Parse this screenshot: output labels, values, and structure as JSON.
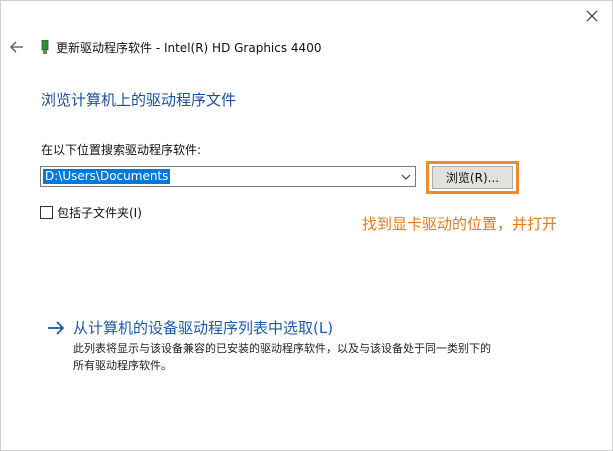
{
  "window": {
    "title": "更新驱动程序软件 - Intel(R) HD Graphics 4400"
  },
  "main": {
    "heading": "浏览计算机上的驱动程序文件",
    "search_label": "在以下位置搜索驱动程序软件:",
    "path_value": "D:\\Users\\Documents",
    "browse_label": "浏览(R)...",
    "include_subfolders_label": "包括子文件夹(I)",
    "include_subfolders_checked": false
  },
  "annotation": {
    "text": "找到显卡驱动的位置，并打开",
    "color": "#e07b20"
  },
  "pick_option": {
    "label": "从计算机的设备驱动程序列表中选取(L)",
    "desc_line1": "此列表将显示与该设备兼容的已安装的驱动程序软件，以及与该设备处于同一类别下的",
    "desc_line2": "所有驱动程序软件。"
  },
  "icons": {
    "close": "close-icon",
    "back": "back-arrow-icon",
    "device": "device-icon",
    "dropdown": "chevron-down-icon",
    "link_arrow": "arrow-right-icon"
  },
  "colors": {
    "heading_blue": "#1f4e9a",
    "link_blue": "#1c5aa6",
    "selection_blue": "#0078d7",
    "highlight_orange": "#f08a2e"
  }
}
